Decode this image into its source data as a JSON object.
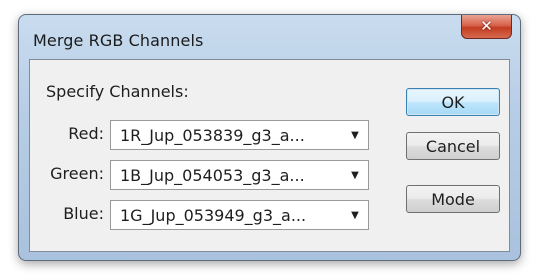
{
  "window": {
    "title": "Merge RGB Channels",
    "close_icon": "close-icon"
  },
  "dialog": {
    "section_label": "Specify Channels:",
    "channels": [
      {
        "label": "Red:",
        "value": "1R_Jup_053839_g3_a..."
      },
      {
        "label": "Green:",
        "value": "1B_Jup_054053_g3_a..."
      },
      {
        "label": "Blue:",
        "value": "1G_Jup_053949_g3_a..."
      }
    ],
    "buttons": {
      "ok": "OK",
      "cancel": "Cancel",
      "mode": "Mode"
    }
  }
}
